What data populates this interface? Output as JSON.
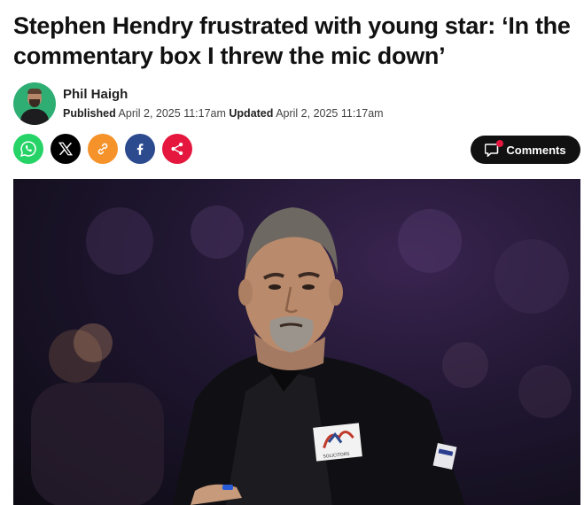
{
  "article": {
    "headline": "Stephen Hendry frustrated with young star: ‘In the commentary box I threw the mic down’"
  },
  "author": {
    "name": "Phil Haigh",
    "published_label": "Published",
    "published_date": "April 2, 2025 11:17am",
    "updated_label": "Updated",
    "updated_date": "April 2, 2025 11:17am"
  },
  "share": {
    "buttons": [
      {
        "icon": "whatsapp-icon",
        "color": "#25d366"
      },
      {
        "icon": "x-icon",
        "color": "#000000"
      },
      {
        "icon": "link-icon",
        "color": "#f5922a"
      },
      {
        "icon": "facebook-icon",
        "color": "#2c4b8f"
      },
      {
        "icon": "share-icon",
        "color": "#e5173f"
      }
    ]
  },
  "comments": {
    "label": "Comments",
    "icon": "comment-icon",
    "accent": "#e5173f"
  },
  "hero_image": {
    "patch_text": "SOLICITORS"
  }
}
